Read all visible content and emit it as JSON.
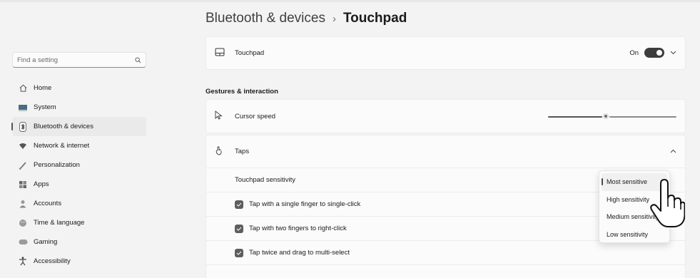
{
  "search": {
    "placeholder": "Find a setting"
  },
  "nav": [
    {
      "label": "Home",
      "icon": "home-icon"
    },
    {
      "label": "System",
      "icon": "system-icon"
    },
    {
      "label": "Bluetooth & devices",
      "icon": "bluetooth-icon",
      "active": true
    },
    {
      "label": "Network & internet",
      "icon": "wifi-icon"
    },
    {
      "label": "Personalization",
      "icon": "brush-icon"
    },
    {
      "label": "Apps",
      "icon": "apps-icon"
    },
    {
      "label": "Accounts",
      "icon": "accounts-icon"
    },
    {
      "label": "Time & language",
      "icon": "globe-icon"
    },
    {
      "label": "Gaming",
      "icon": "gamepad-icon"
    },
    {
      "label": "Accessibility",
      "icon": "accessibility-icon"
    }
  ],
  "breadcrumb": {
    "parent": "Bluetooth & devices",
    "separator": "›",
    "current": "Touchpad"
  },
  "touchpad": {
    "label": "Touchpad",
    "state": "On"
  },
  "section": {
    "title": "Gestures & interaction"
  },
  "cursor": {
    "label": "Cursor speed",
    "value_fraction": 0.45
  },
  "taps": {
    "label": "Taps",
    "sensitivity_label": "Touchpad sensitivity",
    "options": [
      {
        "label": "Tap with a single finger to single-click",
        "checked": true
      },
      {
        "label": "Tap with two fingers to right-click",
        "checked": true
      },
      {
        "label": "Tap twice and drag to multi-select",
        "checked": true
      }
    ]
  },
  "sensitivity_dropdown": {
    "items": [
      "Most sensitive",
      "High sensitivity",
      "Medium sensitivity",
      "Low sensitivity"
    ],
    "selected": "Most sensitive"
  }
}
